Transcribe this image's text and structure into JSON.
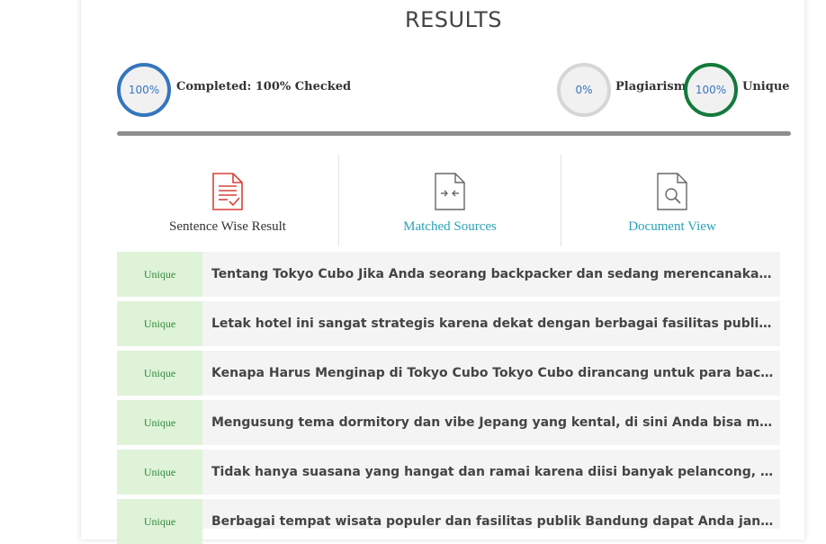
{
  "results": {
    "title": "RESULTS",
    "completed": {
      "percent": "100%",
      "label": "Completed: 100% Checked"
    },
    "plagiarism": {
      "percent": "0%",
      "label": "Plagiarism"
    },
    "unique": {
      "percent": "100%",
      "label": "Unique"
    },
    "progress": 1.0
  },
  "tabs": [
    {
      "label": "Sentence Wise Result",
      "icon": "document-check-icon",
      "active": true
    },
    {
      "label": "Matched Sources",
      "icon": "document-compare-icon",
      "active": false
    },
    {
      "label": "Document View",
      "icon": "document-search-icon",
      "active": false
    }
  ],
  "rows": [
    {
      "badge": "Unique",
      "text": "Tentang Tokyo Cubo Jika Anda seorang backpacker dan sedang merencanakan perjalanan ke Bandung"
    },
    {
      "badge": "Unique",
      "text": "Letak hotel ini sangat strategis karena dekat dengan berbagai fasilitas publik, mulai dari stasiun"
    },
    {
      "badge": "Unique",
      "text": "Kenapa Harus Menginap di Tokyo Cubo Tokyo Cubo dirancang untuk para backpacker agar nyaman"
    },
    {
      "badge": "Unique",
      "text": "Mengusung tema dormitory dan vibe Jepang yang kental, di sini Anda bisa menyewa satu ranjang"
    },
    {
      "badge": "Unique",
      "text": "Tidak hanya suasana yang hangat dan ramai karena diisi banyak pelancong, Tokyo Cubo juga nyaman"
    },
    {
      "badge": "Unique",
      "text": "Berbagai tempat wisata populer dan fasilitas publik Bandung dapat Anda jangkau dengan mudah"
    }
  ],
  "colors": {
    "completed_ring": "#3576be",
    "plagiarism_ring": "#d6d6d6",
    "unique_ring": "#127a3b",
    "badge_bg": "#dff3d8",
    "link": "#2aa1b5",
    "icon_active": "#d9413b",
    "icon_inactive": "#666666"
  }
}
